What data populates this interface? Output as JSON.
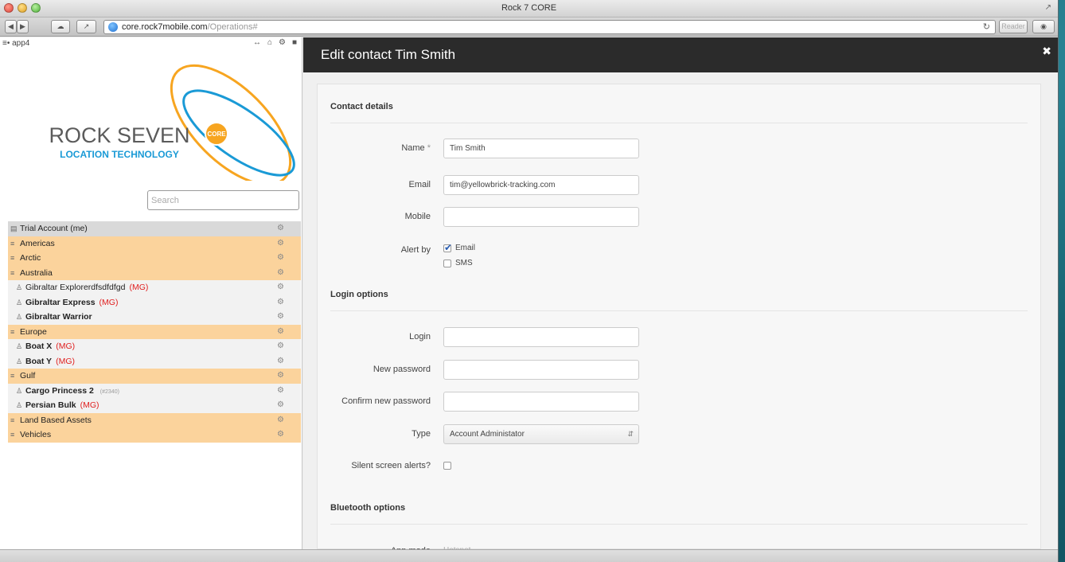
{
  "window": {
    "title": "Rock 7 CORE",
    "url_host": "core.rock7mobile.com",
    "url_path": "/Operations#",
    "reader_label": "Reader"
  },
  "sidebar": {
    "app_name": "app4",
    "logo": {
      "line1": "ROCK SEVEN",
      "line2": "LOCATION TECHNOLOGY",
      "badge": "CORE"
    },
    "search_placeholder": "Search",
    "items": [
      {
        "kind": "account",
        "label": "Trial Account (me)",
        "bold": false,
        "tag": "",
        "id": ""
      },
      {
        "kind": "group",
        "label": "Americas",
        "bold": false,
        "tag": "",
        "id": ""
      },
      {
        "kind": "group",
        "label": "Arctic",
        "bold": false,
        "tag": "",
        "id": ""
      },
      {
        "kind": "group",
        "label": "Australia",
        "bold": false,
        "tag": "",
        "id": ""
      },
      {
        "kind": "asset",
        "label": "Gibraltar Explorerdfsdfdfgd",
        "bold": false,
        "tag": "(MG)",
        "id": ""
      },
      {
        "kind": "asset",
        "label": "Gibraltar Express",
        "bold": true,
        "tag": "(MG)",
        "id": ""
      },
      {
        "kind": "asset",
        "label": "Gibraltar Warrior",
        "bold": true,
        "tag": "",
        "id": ""
      },
      {
        "kind": "group",
        "label": "Europe",
        "bold": false,
        "tag": "",
        "id": ""
      },
      {
        "kind": "asset",
        "label": "Boat X",
        "bold": true,
        "tag": "(MG)",
        "id": ""
      },
      {
        "kind": "asset",
        "label": "Boat Y",
        "bold": true,
        "tag": "(MG)",
        "id": ""
      },
      {
        "kind": "group",
        "label": "Gulf",
        "bold": false,
        "tag": "",
        "id": ""
      },
      {
        "kind": "asset",
        "label": "Cargo Princess 2",
        "bold": true,
        "tag": "",
        "id": "(#2340)"
      },
      {
        "kind": "asset",
        "label": "Persian Bulk",
        "bold": true,
        "tag": "(MG)",
        "id": ""
      },
      {
        "kind": "group",
        "label": "Land Based Assets",
        "bold": false,
        "tag": "",
        "id": ""
      },
      {
        "kind": "group",
        "label": "Vehicles",
        "bold": false,
        "tag": "",
        "id": ""
      }
    ]
  },
  "modal": {
    "title": "Edit contact Tim Smith",
    "contact_section": "Contact details",
    "name_label": "Name",
    "name_required": "*",
    "name_value": "Tim Smith",
    "email_label": "Email",
    "email_value": "tim@yellowbrick-tracking.com",
    "mobile_label": "Mobile",
    "mobile_value": "",
    "alert_by_label": "Alert by",
    "alert_email_label": "Email",
    "alert_email_checked": true,
    "alert_sms_label": "SMS",
    "alert_sms_checked": false,
    "login_section": "Login options",
    "login_label": "Login",
    "login_value": "",
    "new_password_label": "New password",
    "confirm_password_label": "Confirm new password",
    "type_label": "Type",
    "type_value": "Account Administator",
    "silent_alerts_label": "Silent screen alerts?",
    "silent_alerts_checked": false,
    "bluetooth_section": "Bluetooth options",
    "app_mode_label": "App mode",
    "app_mode_value": "Hotspot"
  },
  "colors": {
    "group_row": "#fbd39c",
    "account_row": "#d9d9d9",
    "asset_row": "#f2f2f2",
    "tag_red": "#e02020",
    "modal_header": "#2b2b2b",
    "logo_blue": "#1a9ad6",
    "logo_orange": "#f7a520"
  }
}
